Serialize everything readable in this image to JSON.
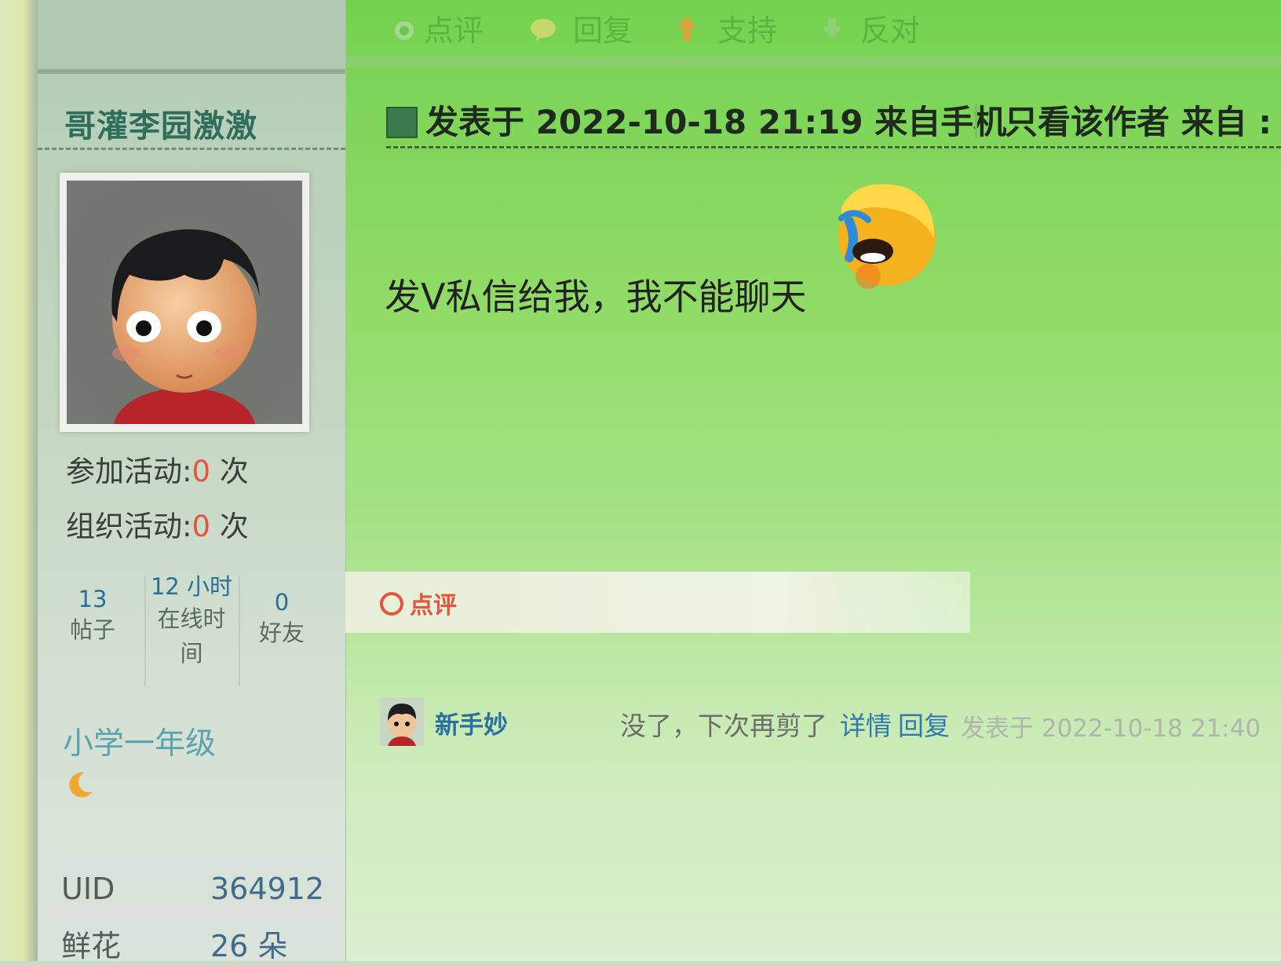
{
  "top_actions": [
    {
      "label": "点评",
      "icon": "comment-dot-icon"
    },
    {
      "label": "回复",
      "icon": "reply-bubble-icon"
    },
    {
      "label": "支持",
      "icon": "thumbs-up-icon"
    },
    {
      "label": "反对",
      "icon": "thumbs-down-icon"
    }
  ],
  "sidebar": {
    "username": "哥灌李园激激",
    "avatar": "cartoon-boy-avatar",
    "activities": [
      {
        "label": "参加活动:",
        "value": "0",
        "unit": " 次"
      },
      {
        "label": "组织活动:",
        "value": "0",
        "unit": " 次"
      }
    ],
    "mini_stats": [
      {
        "value": "13",
        "label": "帖子"
      },
      {
        "value": "12 小时",
        "label_line1": "在线时",
        "label_line2": "间"
      },
      {
        "value": "0",
        "label": "好友"
      }
    ],
    "rank": "小学一年级",
    "rank_icon": "moon-icon",
    "profile": [
      {
        "label": "UID",
        "value": "364912"
      },
      {
        "label": "鲜花",
        "value": "26 朵"
      }
    ]
  },
  "post": {
    "meta_left": "发表于 2022-10-18 21:19 来自手机",
    "meta_right": "只看该作者 来自 :",
    "content": "发V私信给我，我不能聊天",
    "emoji": "crying-face-emoji",
    "comment_label": "点评"
  },
  "reply": {
    "user": "新手妙",
    "text": "没了，下次再剪了",
    "detail_link": "详情",
    "reply_link": "回复",
    "meta": "发表于 2022-10-18 21:40"
  },
  "colors": {
    "accent_red": "#e4563b",
    "link_blue": "#2a6fa0",
    "bg_green": "#8fdb66"
  }
}
